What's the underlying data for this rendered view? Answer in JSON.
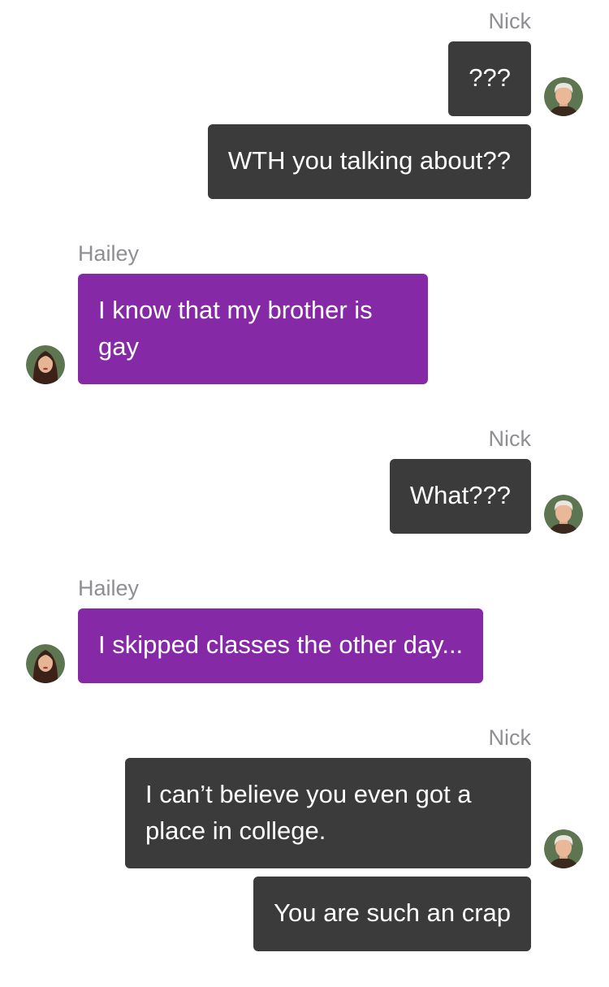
{
  "messages": [
    {
      "sender": "Nick",
      "side": "right",
      "bubbles": [
        "???",
        "WTH you talking about??"
      ]
    },
    {
      "sender": "Hailey",
      "side": "left",
      "bubbles": [
        "I know that my brother is gay"
      ]
    },
    {
      "sender": "Nick",
      "side": "right",
      "bubbles": [
        "What???"
      ]
    },
    {
      "sender": "Hailey",
      "side": "left",
      "bubbles": [
        "I skipped classes the other day..."
      ]
    },
    {
      "sender": "Nick",
      "side": "right",
      "bubbles": [
        "I can’t believe you even got a place in college.",
        "You are such an crap"
      ]
    }
  ],
  "avatars": {
    "nick": "nick-avatar-icon",
    "hailey": "hailey-avatar-icon"
  },
  "colors": {
    "nick_bubble": "#3b3b3b",
    "hailey_bubble": "#8629a7",
    "sender_name": "#8e8e93",
    "background": "#ffffff"
  }
}
